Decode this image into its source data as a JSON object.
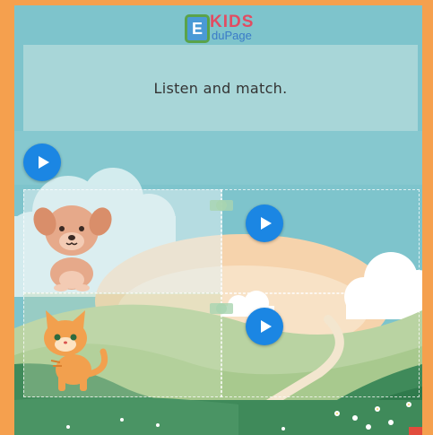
{
  "logo": {
    "letter": "E",
    "kids": "KIDS",
    "page": "duPage"
  },
  "instruction": {
    "text": "Listen and match."
  },
  "audio_buttons": [
    {
      "name": "main-audio"
    },
    {
      "name": "row-1-audio"
    },
    {
      "name": "row-2-audio"
    }
  ],
  "items": [
    {
      "animal": "dog"
    },
    {
      "animal": "cat"
    }
  ],
  "colors": {
    "background": "#f5a04e",
    "sky": "#7ec4cc",
    "banner": "#a8d6d8",
    "play": "#1b86e3"
  }
}
